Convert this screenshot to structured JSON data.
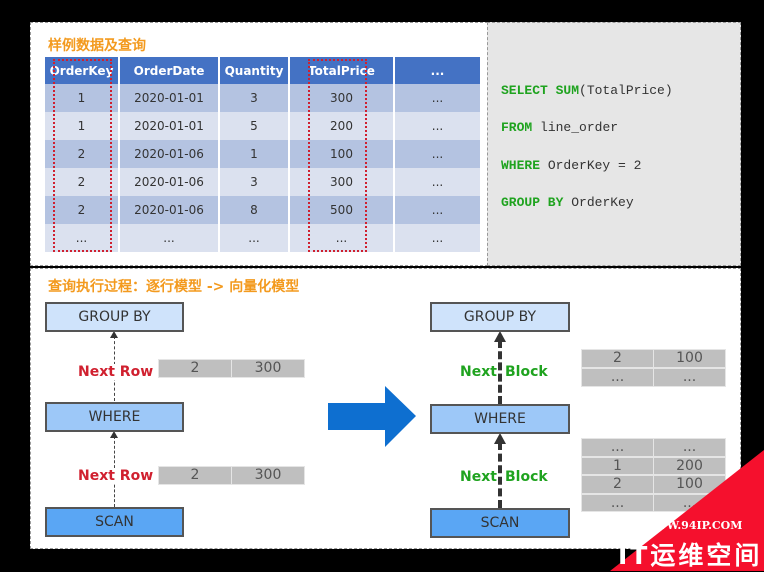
{
  "sample": {
    "title": "样例数据及查询",
    "columns": [
      "OrderKey",
      "OrderDate",
      "Quantity",
      "TotalPrice",
      "..."
    ],
    "rows": [
      [
        "1",
        "2020-01-01",
        "3",
        "300",
        "..."
      ],
      [
        "1",
        "2020-01-01",
        "5",
        "200",
        "..."
      ],
      [
        "2",
        "2020-01-06",
        "1",
        "100",
        "..."
      ],
      [
        "2",
        "2020-01-06",
        "3",
        "300",
        "..."
      ],
      [
        "2",
        "2020-01-06",
        "8",
        "500",
        "..."
      ],
      [
        "...",
        "...",
        "...",
        "...",
        "..."
      ]
    ]
  },
  "sql": {
    "l1k1": "SELECT",
    "l1k2": "SUM",
    "l1t": "(TotalPrice)",
    "l2k": "FROM",
    "l2t": "line_order",
    "l3k": "WHERE",
    "l3t": "OrderKey = 2",
    "l4k": "GROUP BY",
    "l4t": "OrderKey"
  },
  "process": {
    "title": "查询执行过程：逐行模型 -> 向量化模型",
    "row_model": {
      "ops": [
        "GROUP BY",
        "WHERE",
        "SCAN"
      ],
      "label": "Next Row",
      "upper": [
        "2",
        "300"
      ],
      "lower": [
        "2",
        "300"
      ]
    },
    "vector_model": {
      "ops": [
        "GROUP BY",
        "WHERE",
        "SCAN"
      ],
      "label_a": "Next",
      "label_b": "Block",
      "upper": [
        [
          "2",
          "100"
        ],
        [
          "...",
          "..."
        ]
      ],
      "lower": [
        [
          "...",
          "..."
        ],
        [
          "1",
          "200"
        ],
        [
          "2",
          "100"
        ],
        [
          "...",
          "..."
        ]
      ]
    }
  },
  "watermark": {
    "url": "WWW.94IP.COM",
    "name": "IT运维空间"
  },
  "colors": {
    "orange": "#f39a1e",
    "header": "#4472c4",
    "red": "#d0202f",
    "green": "#1fa31f",
    "arrow": "#0e6fd0"
  }
}
